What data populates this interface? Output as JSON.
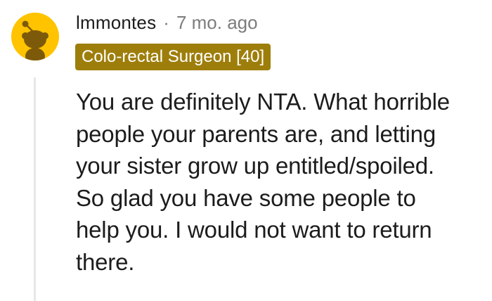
{
  "comment": {
    "author": "lmmontes",
    "separator": "·",
    "time_ago": "7 mo. ago",
    "flair": "Colo-rectal Surgeon [40]",
    "body_lines": [
      "You are definitely NTA. What horrible",
      "people your parents are, and letting",
      "your sister grow up entitled/spoiled.",
      "So glad you have some people to",
      "help you. I would not want to return",
      "there."
    ]
  },
  "colors": {
    "avatar_bg": "#ffc300",
    "flair_bg": "#9e7e0b",
    "flair_text": "#ffffff",
    "body_text": "#1c1c1c",
    "meta_text": "#7c7c7c",
    "thread_line": "#e7e7e7"
  },
  "icons": {
    "avatar": "reddit-snoo-avatar-icon"
  }
}
